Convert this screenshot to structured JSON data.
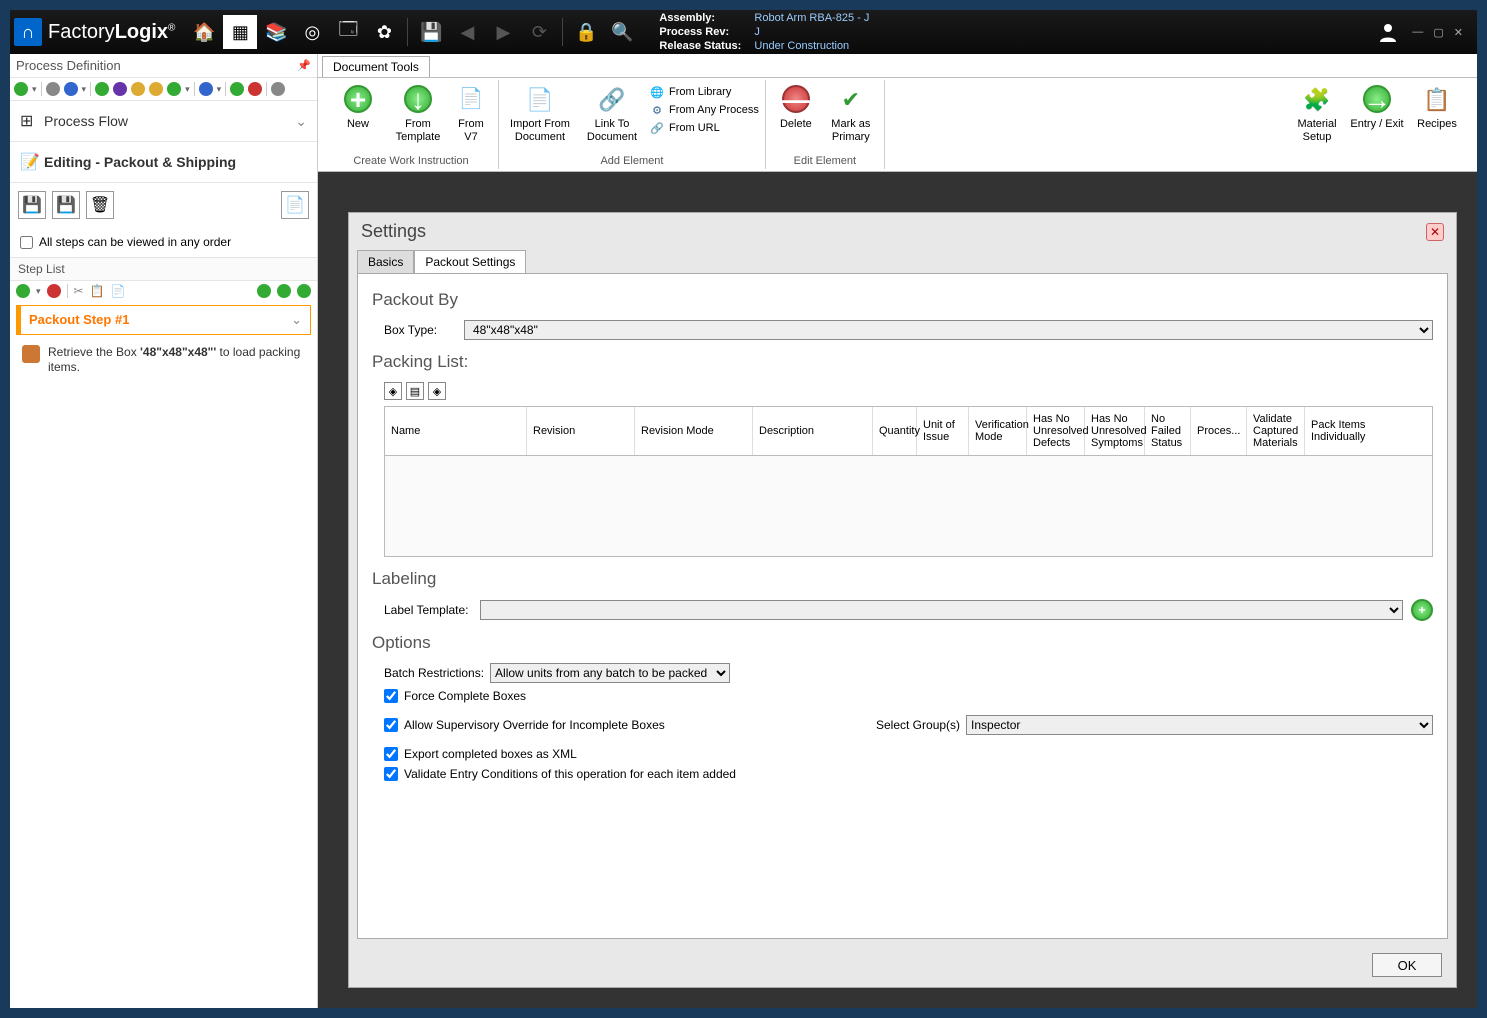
{
  "app": {
    "name_a": "Factory",
    "name_b": "Logix"
  },
  "title_info": {
    "assembly_lbl": "Assembly:",
    "assembly_val": "Robot Arm RBA-825 - J",
    "rev_lbl": "Process Rev:",
    "rev_val": "J",
    "status_lbl": "Release Status:",
    "status_val": "Under Construction"
  },
  "sidebar": {
    "header": "Process Definition",
    "process_flow": "Process Flow",
    "editing": "Editing - Packout & Shipping",
    "all_steps_label": "All steps can be viewed in any order",
    "step_list": "Step List",
    "step1": "Packout Step #1",
    "step_desc_pre": "Retrieve the Box ",
    "step_desc_bold": "'48\"x48\"x48\"'",
    "step_desc_post": " to load packing items."
  },
  "ribbon": {
    "doc_tab": "Document Tools",
    "new": "New",
    "from_template": "From Template",
    "from_v7": "From V7",
    "grp_create": "Create Work Instruction",
    "import_from_doc": "Import From Document",
    "link_to_doc": "Link To Document",
    "from_library": "From Library",
    "from_any_process": "From Any Process",
    "from_url": "From URL",
    "grp_add": "Add Element",
    "delete": "Delete",
    "mark_primary": "Mark as Primary",
    "grp_edit": "Edit Element",
    "material_setup": "Material Setup",
    "entry_exit": "Entry / Exit",
    "recipes": "Recipes"
  },
  "settings": {
    "title": "Settings",
    "tab_basics": "Basics",
    "tab_packout": "Packout Settings",
    "packout_by": "Packout By",
    "box_type_lbl": "Box Type:",
    "box_type_val": "48\"x48\"x48\"",
    "packing_list": "Packing List:",
    "cols": {
      "name": "Name",
      "revision": "Revision",
      "rev_mode": "Revision Mode",
      "description": "Description",
      "quantity": "Quantity",
      "unit": "Unit of Issue",
      "verif": "Verification Mode",
      "defects": "Has No Unresolved Defects",
      "symptoms": "Has No Unresolved Symptoms",
      "failed": "No Failed Status",
      "process": "Proces...",
      "validate": "Validate Captured Materials",
      "pack": "Pack Items Individually"
    },
    "labeling": "Labeling",
    "label_template": "Label Template:",
    "options": "Options",
    "batch_lbl": "Batch Restrictions:",
    "batch_val": "Allow units from any batch to be packed",
    "force_complete": "Force Complete Boxes",
    "allow_override": "Allow Supervisory Override for Incomplete Boxes",
    "select_group_lbl": "Select Group(s)",
    "select_group_val": "Inspector",
    "export_xml": "Export completed boxes as XML",
    "validate_entry": "Validate Entry Conditions of this operation for each item added",
    "ok": "OK"
  }
}
